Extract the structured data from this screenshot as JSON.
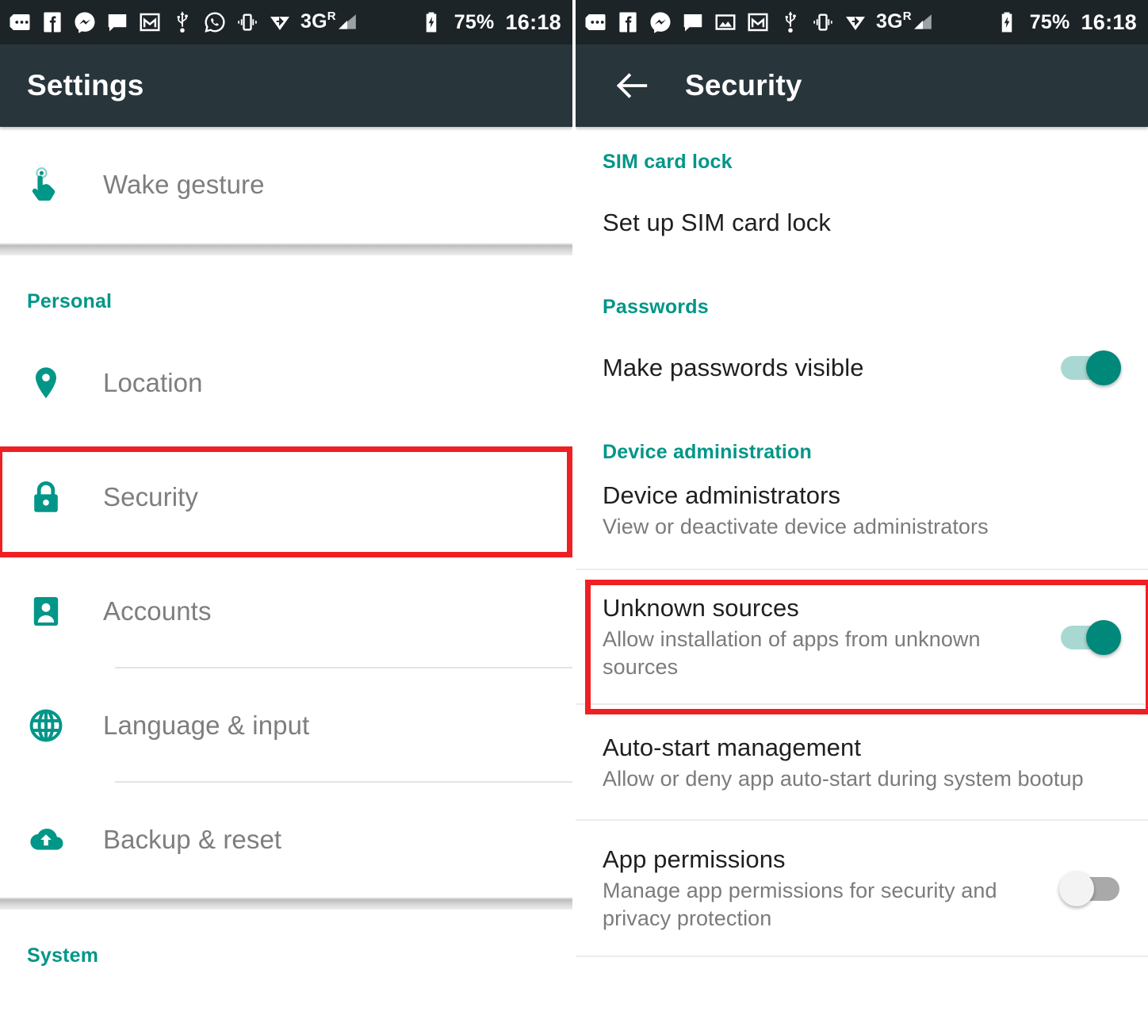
{
  "status_bar": {
    "icons_left": [
      "more-messages-icon",
      "facebook-icon",
      "messenger-icon",
      "sms-chat-icon",
      "photo-icon",
      "gmail-icon",
      "usb-icon",
      "whatsapp-icon",
      "vibrate-icon",
      "data-saver-icon",
      "signal-3g-icon"
    ],
    "icons_left_panel": [
      "more-messages-icon",
      "facebook-icon",
      "messenger-icon",
      "sms-chat-icon",
      "gmail-icon",
      "usb-icon",
      "whatsapp-icon",
      "vibrate-icon",
      "data-saver-icon",
      "signal-3g-icon"
    ],
    "network_label": "3G",
    "network_sup": "R",
    "battery_percent": "75%",
    "clock": "16:18"
  },
  "left_panel": {
    "title": "Settings",
    "rows_top": [
      {
        "icon": "tap-gesture-icon",
        "label": "Wake gesture"
      }
    ],
    "section_personal": "Personal",
    "rows_personal": [
      {
        "icon": "location-pin-icon",
        "label": "Location",
        "divider": false
      },
      {
        "icon": "lock-icon",
        "label": "Security",
        "divider": false
      },
      {
        "icon": "account-icon",
        "label": "Accounts",
        "divider": true
      },
      {
        "icon": "globe-icon",
        "label": "Language & input",
        "divider": true
      },
      {
        "icon": "cloud-upload-icon",
        "label": "Backup & reset",
        "divider": false
      }
    ],
    "section_system": "System",
    "highlight": "Security"
  },
  "right_panel": {
    "title": "Security",
    "back_label": "Back",
    "sections": [
      {
        "header": "SIM card lock",
        "items": [
          {
            "title": "Set up SIM card lock",
            "subtitle": "",
            "toggle": "none"
          }
        ]
      },
      {
        "header": "Passwords",
        "items": [
          {
            "title": "Make passwords visible",
            "subtitle": "",
            "toggle": "on"
          }
        ]
      },
      {
        "header": "Device administration",
        "items": [
          {
            "title": "Device administrators",
            "subtitle": "View or deactivate device administrators",
            "toggle": "none"
          },
          {
            "title": "Unknown sources",
            "subtitle": "Allow installation of apps from unknown sources",
            "toggle": "on"
          },
          {
            "title": "Auto-start management",
            "subtitle": "Allow or deny app auto-start during system bootup",
            "toggle": "none"
          },
          {
            "title": "App permissions",
            "subtitle": "Manage app permissions for security and privacy protection",
            "toggle": "off"
          }
        ]
      }
    ],
    "highlight": "Unknown sources"
  },
  "colors": {
    "accent_teal": "#009688",
    "toggle_on": "#00887a",
    "toggle_on_track": "#a9d8d3",
    "toggle_off_track": "#a9a9a9",
    "status_bar_bg": "#1d2427",
    "app_bar_bg": "#28353b",
    "annotation_red": "#ef2024",
    "title_text": "#1f1f1f",
    "subtitle_text": "#7b7b7b",
    "left_label_text": "#7e7e7e"
  }
}
